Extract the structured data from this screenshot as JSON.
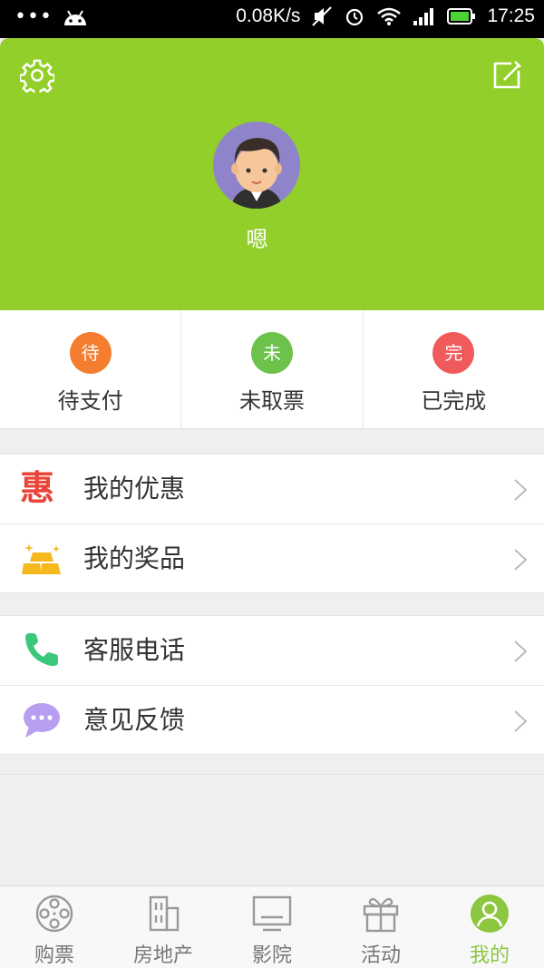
{
  "status_bar": {
    "speed": "0.08K/s",
    "time": "17:25"
  },
  "profile": {
    "username": "嗯"
  },
  "orders": [
    {
      "badge": "待",
      "label": "待支付",
      "color": "#f47d30"
    },
    {
      "badge": "未",
      "label": "未取票",
      "color": "#6cc24a"
    },
    {
      "badge": "完",
      "label": "已完成",
      "color": "#f05a5a"
    }
  ],
  "menu_group_1": [
    {
      "label": "我的优惠",
      "icon": "discount-hui-icon",
      "icon_text": "惠"
    },
    {
      "label": "我的奖品",
      "icon": "gold-bars-icon"
    }
  ],
  "menu_group_2": [
    {
      "label": "客服电话",
      "icon": "phone-icon"
    },
    {
      "label": "意见反馈",
      "icon": "chat-bubble-icon"
    }
  ],
  "tabs": [
    {
      "label": "购票",
      "icon": "film-reel-icon"
    },
    {
      "label": "房地产",
      "icon": "building-icon"
    },
    {
      "label": "影院",
      "icon": "screen-icon"
    },
    {
      "label": "活动",
      "icon": "gift-icon"
    },
    {
      "label": "我的",
      "icon": "person-icon",
      "active": true
    }
  ],
  "colors": {
    "header_green": "#93cf2b",
    "active_tab": "#8dc63f"
  }
}
